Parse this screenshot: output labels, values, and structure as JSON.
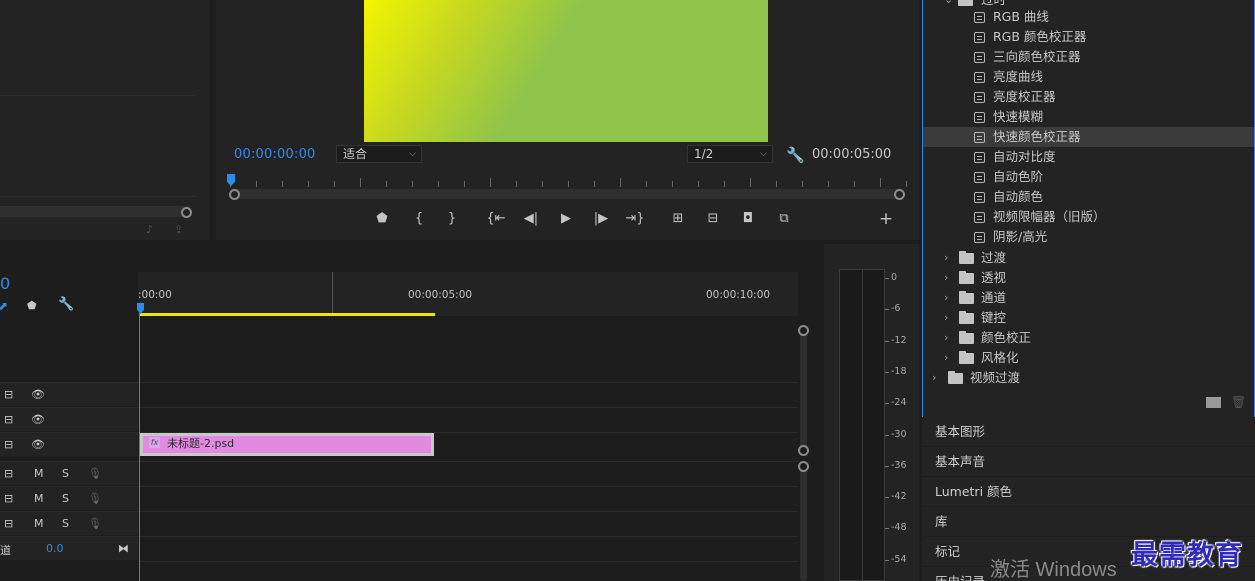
{
  "program_monitor": {
    "current_timecode": "00:00:00:00",
    "fit_option": "适合",
    "resolution_option": "1/2",
    "duration_timecode": "00:00:05:00"
  },
  "effects_panel": {
    "parent_group_label": "过时",
    "items": [
      "RGB 曲线",
      "RGB 颜色校正器",
      "三向颜色校正器",
      "亮度曲线",
      "亮度校正器",
      "快速模糊",
      "快速颜色校正器",
      "自动对比度",
      "自动色阶",
      "自动颜色",
      "视频限幅器（旧版）",
      "阴影/高光"
    ],
    "selected_item": "快速颜色校正器",
    "folders": [
      "过渡",
      "透视",
      "通道",
      "键控",
      "颜色校正",
      "风格化"
    ],
    "root_folder": "视频过渡"
  },
  "collapsed_panels": [
    "基本图形",
    "基本声音",
    "Lumetri 颜色",
    "库",
    "标记",
    "历史记录"
  ],
  "timeline": {
    "timecode": "0",
    "ruler_labels": [
      ":00:00",
      "00:00:05:00",
      "00:00:10:00"
    ],
    "clip_name": "未标题-2.psd",
    "mix_track_label": "道",
    "mix_value": "0.0",
    "audio_m": "M",
    "audio_s": "S"
  },
  "audio_meter": {
    "db_labels": [
      "0",
      "-6",
      "-12",
      "-18",
      "-24",
      "-30",
      "-36",
      "-42",
      "-48",
      "-54"
    ]
  },
  "watermark": {
    "activate_windows": "激活 Windows",
    "logo_text": "最需教育"
  },
  "colors": {
    "accent_blue": "#2d8ceb",
    "clip_pink": "#e28ae2",
    "work_area_yellow": "#e8e800",
    "video_green": "#8ec44a"
  }
}
